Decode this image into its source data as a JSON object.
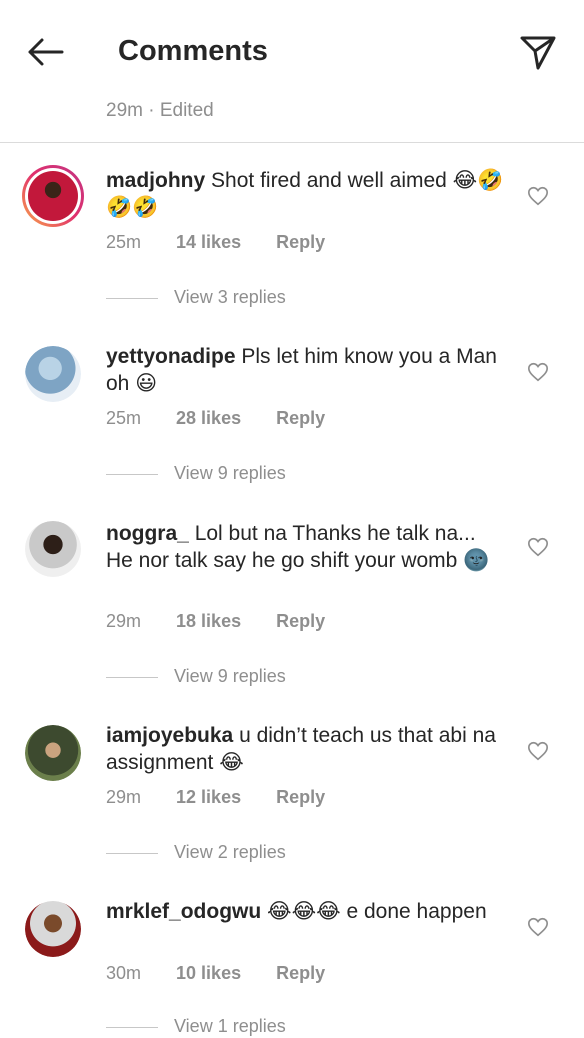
{
  "header": {
    "title": "Comments",
    "meta": "29m · Edited"
  },
  "comments": [
    {
      "username": "madjohny",
      "text": "Shot fired and well aimed 😂🤣🤣🤣",
      "time": "25m",
      "likes": "14 likes",
      "reply": "Reply",
      "view_replies": "View 3 replies"
    },
    {
      "username": "yettyonadipe",
      "text": "Pls let him know you a Man oh 😃",
      "time": "25m",
      "likes": "28 likes",
      "reply": "Reply",
      "view_replies": "View 9 replies"
    },
    {
      "username": "noggra_",
      "text": "Lol but na Thanks he talk na... He nor talk say he go shift your womb 🌚",
      "time": "29m",
      "likes": "18 likes",
      "reply": "Reply",
      "view_replies": "View 9 replies"
    },
    {
      "username": "iamjoyebuka",
      "text": "u didn’t teach us that  abi na assignment 😂",
      "time": "29m",
      "likes": "12 likes",
      "reply": "Reply",
      "view_replies": "View 2 replies"
    },
    {
      "username": "mrklef_odogwu",
      "text": "😂😂😂 e done happen",
      "time": "30m",
      "likes": "10 likes",
      "reply": "Reply",
      "view_replies": "View 1 replies"
    }
  ]
}
